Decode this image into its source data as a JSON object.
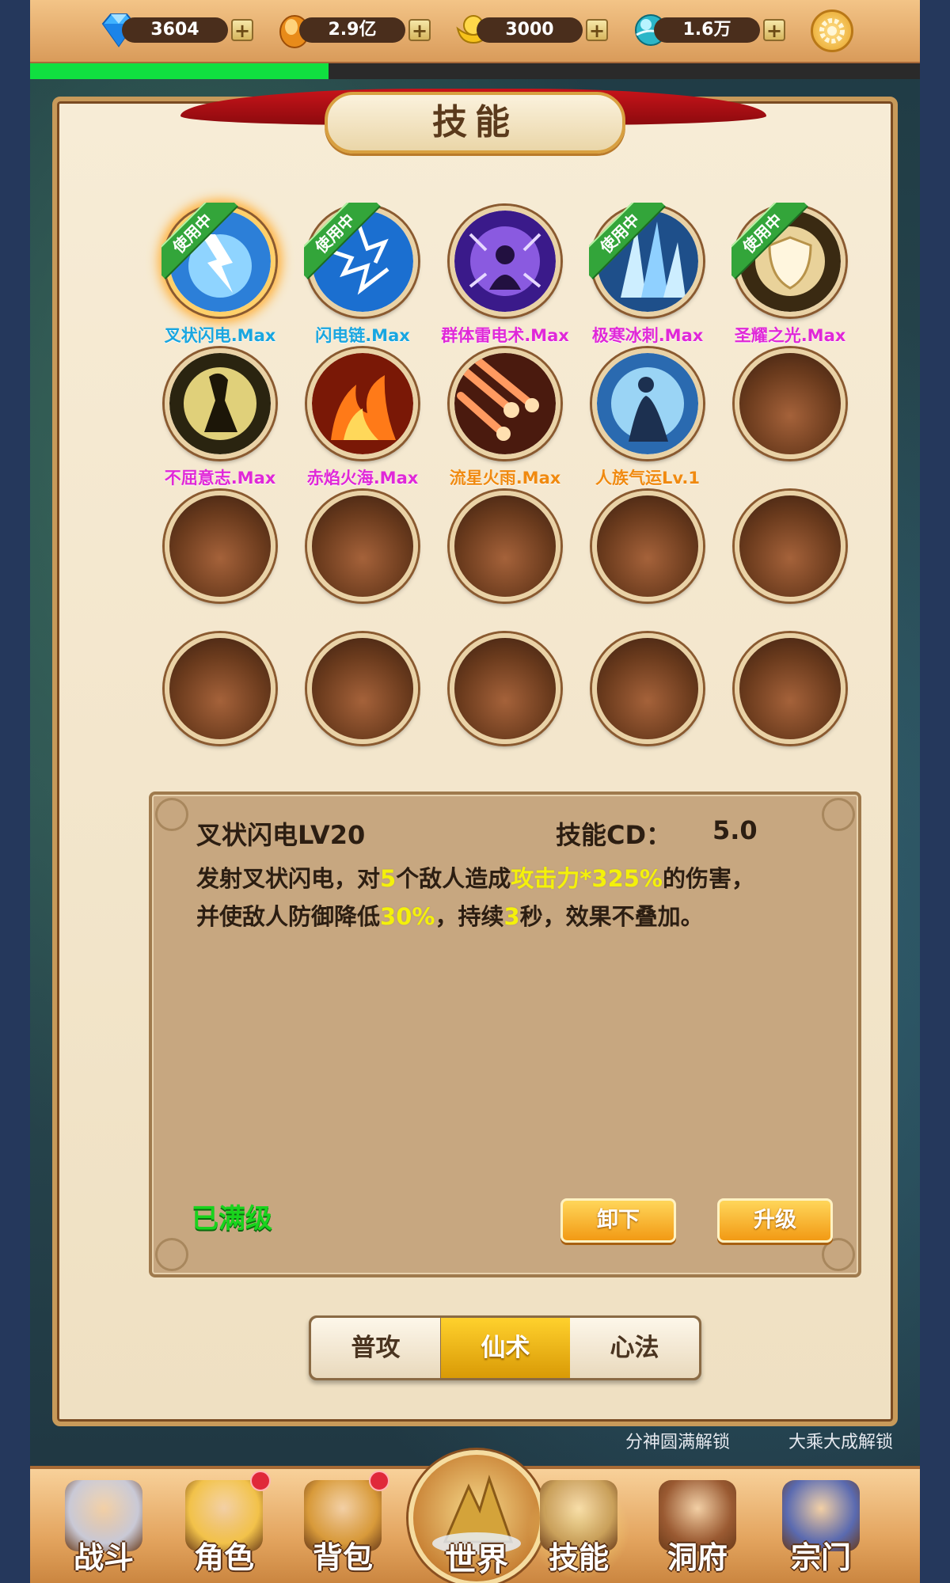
{
  "resources": [
    {
      "id": "diamond",
      "value": "3604",
      "icon": "diamond-icon",
      "plus": "+"
    },
    {
      "id": "gold",
      "value": "2.9亿",
      "icon": "gold-ingot-icon",
      "plus": "+"
    },
    {
      "id": "ingot",
      "value": "3000",
      "icon": "yuanbao-icon",
      "plus": "+"
    },
    {
      "id": "spirit",
      "value": "1.6万",
      "icon": "spirit-orb-icon",
      "plus": "+"
    }
  ],
  "progress": {
    "fraction": 0.335,
    "color": "#10e040"
  },
  "panel": {
    "title": "技能"
  },
  "in_use_label": "使用中",
  "skills": [
    {
      "name": "叉状闪电.Max",
      "color": "#19a6e0",
      "in_use": true,
      "selected": true,
      "icon": "forked-lightning-icon"
    },
    {
      "name": "闪电链.Max",
      "color": "#19a6e0",
      "in_use": true,
      "icon": "chain-lightning-icon"
    },
    {
      "name": "群体雷电术.Max",
      "color": "#e028d8",
      "in_use": false,
      "icon": "mass-thunder-icon"
    },
    {
      "name": "极寒冰刺.Max",
      "color": "#e028d8",
      "in_use": true,
      "icon": "ice-spike-icon"
    },
    {
      "name": "圣耀之光.Max",
      "color": "#e028d8",
      "in_use": true,
      "icon": "holy-shield-icon"
    },
    {
      "name": "不屈意志.Max",
      "color": "#e028d8",
      "in_use": false,
      "icon": "unyielding-will-icon"
    },
    {
      "name": "赤焰火海.Max",
      "color": "#e028d8",
      "in_use": false,
      "icon": "fire-sea-icon"
    },
    {
      "name": "流星火雨.Max",
      "color": "#f08a10",
      "in_use": false,
      "icon": "meteor-rain-icon"
    },
    {
      "name": "人族气运Lv.1",
      "color": "#f08a10",
      "in_use": false,
      "icon": "human-fortune-icon"
    }
  ],
  "empty_slots": 11,
  "detail": {
    "title": "叉状闪电LV20",
    "cd_label": "技能CD：",
    "cd_value": "5.0",
    "line1": [
      {
        "t": "发射叉状闪电，对",
        "hl": false
      },
      {
        "t": "5",
        "hl": true
      },
      {
        "t": "个敌人造成",
        "hl": false
      },
      {
        "t": "攻击力*325%",
        "hl": true
      },
      {
        "t": "的伤害，",
        "hl": false
      }
    ],
    "line2": [
      {
        "t": "并使敌人防御降低",
        "hl": false
      },
      {
        "t": "30%",
        "hl": true
      },
      {
        "t": "，持续",
        "hl": false
      },
      {
        "t": "3",
        "hl": true
      },
      {
        "t": "秒，效果不叠加。",
        "hl": false
      }
    ],
    "status": "已满级",
    "unequip": "卸下",
    "upgrade": "升级"
  },
  "tabs": [
    {
      "label": "普攻",
      "active": false
    },
    {
      "label": "仙术",
      "active": true
    },
    {
      "label": "心法",
      "active": false
    }
  ],
  "unlock_hints": [
    "分神圆满解锁",
    "大乘大成解锁"
  ],
  "nav": [
    {
      "label": "战斗",
      "icon": "crossed-swords-icon",
      "dot": false
    },
    {
      "label": "角色",
      "icon": "characters-icon",
      "dot": true
    },
    {
      "label": "背包",
      "icon": "bag-icon",
      "dot": true
    },
    {
      "label": "世界",
      "icon": "world-mountain-icon",
      "dot": false,
      "center": true
    },
    {
      "label": "技能",
      "icon": "skill-scroll-icon",
      "dot": false,
      "active": true
    },
    {
      "label": "洞府",
      "icon": "cave-dwelling-icon",
      "dot": false
    },
    {
      "label": "宗门",
      "icon": "sect-gate-icon",
      "dot": false
    }
  ]
}
